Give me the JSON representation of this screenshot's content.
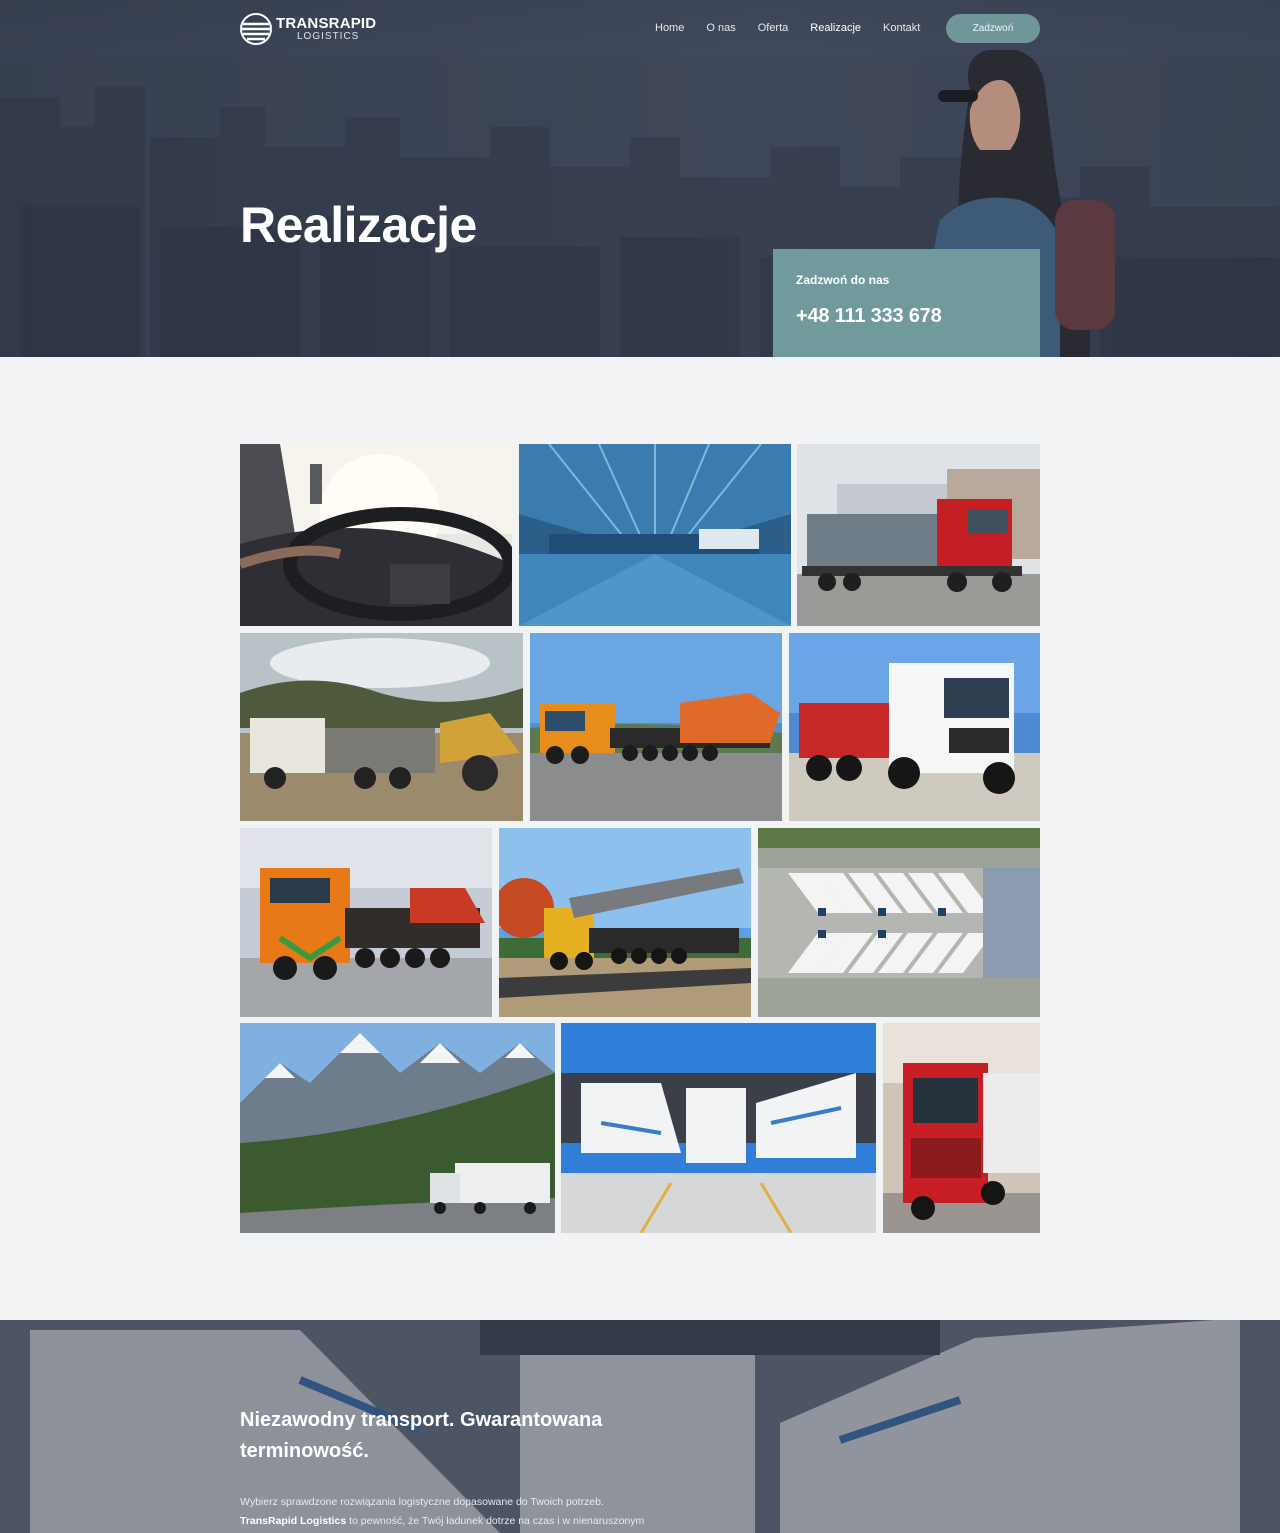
{
  "header": {
    "logo_main": "TRANSRAPID",
    "logo_sub": "LOGISTICS",
    "nav": [
      "Home",
      "O nas",
      "Oferta",
      "Realizacje",
      "Kontakt"
    ],
    "active_nav": "Realizacje",
    "call_button": "Zadzwoń"
  },
  "hero": {
    "title": "Realizacje",
    "call_label": "Zadzwoń do nas",
    "phone": "+48 111 333 678"
  },
  "gallery": {
    "photos": [
      "truck-cabin-steering-photo",
      "warehouse-interior-photo",
      "red-truck-covered-load-photo",
      "dump-truck-quarry-photo",
      "heavy-haul-excavator-transport-photo",
      "white-scania-dump-truck-photo",
      "orange-heavy-haul-truck-photo",
      "crane-transport-truck-photo",
      "aerial-trailer-parking-photo",
      "mountain-road-truck-photo",
      "loading-dock-trailers-photo",
      "red-scania-truck-photo"
    ]
  },
  "band": {
    "title": "Niezawodny transport. Gwarantowana terminowość.",
    "line1": "Wybierz sprawdzone rozwiązania logistyczne dopasowane do Twoich potrzeb.",
    "brand": "TransRapid Logistics",
    "line2": "to pewność, że Twój ładunek dotrze na czas i w nienaruszonym"
  },
  "colors": {
    "accent": "#719a9c",
    "button": "#6f9797",
    "page_bg": "#f1f3f5"
  }
}
